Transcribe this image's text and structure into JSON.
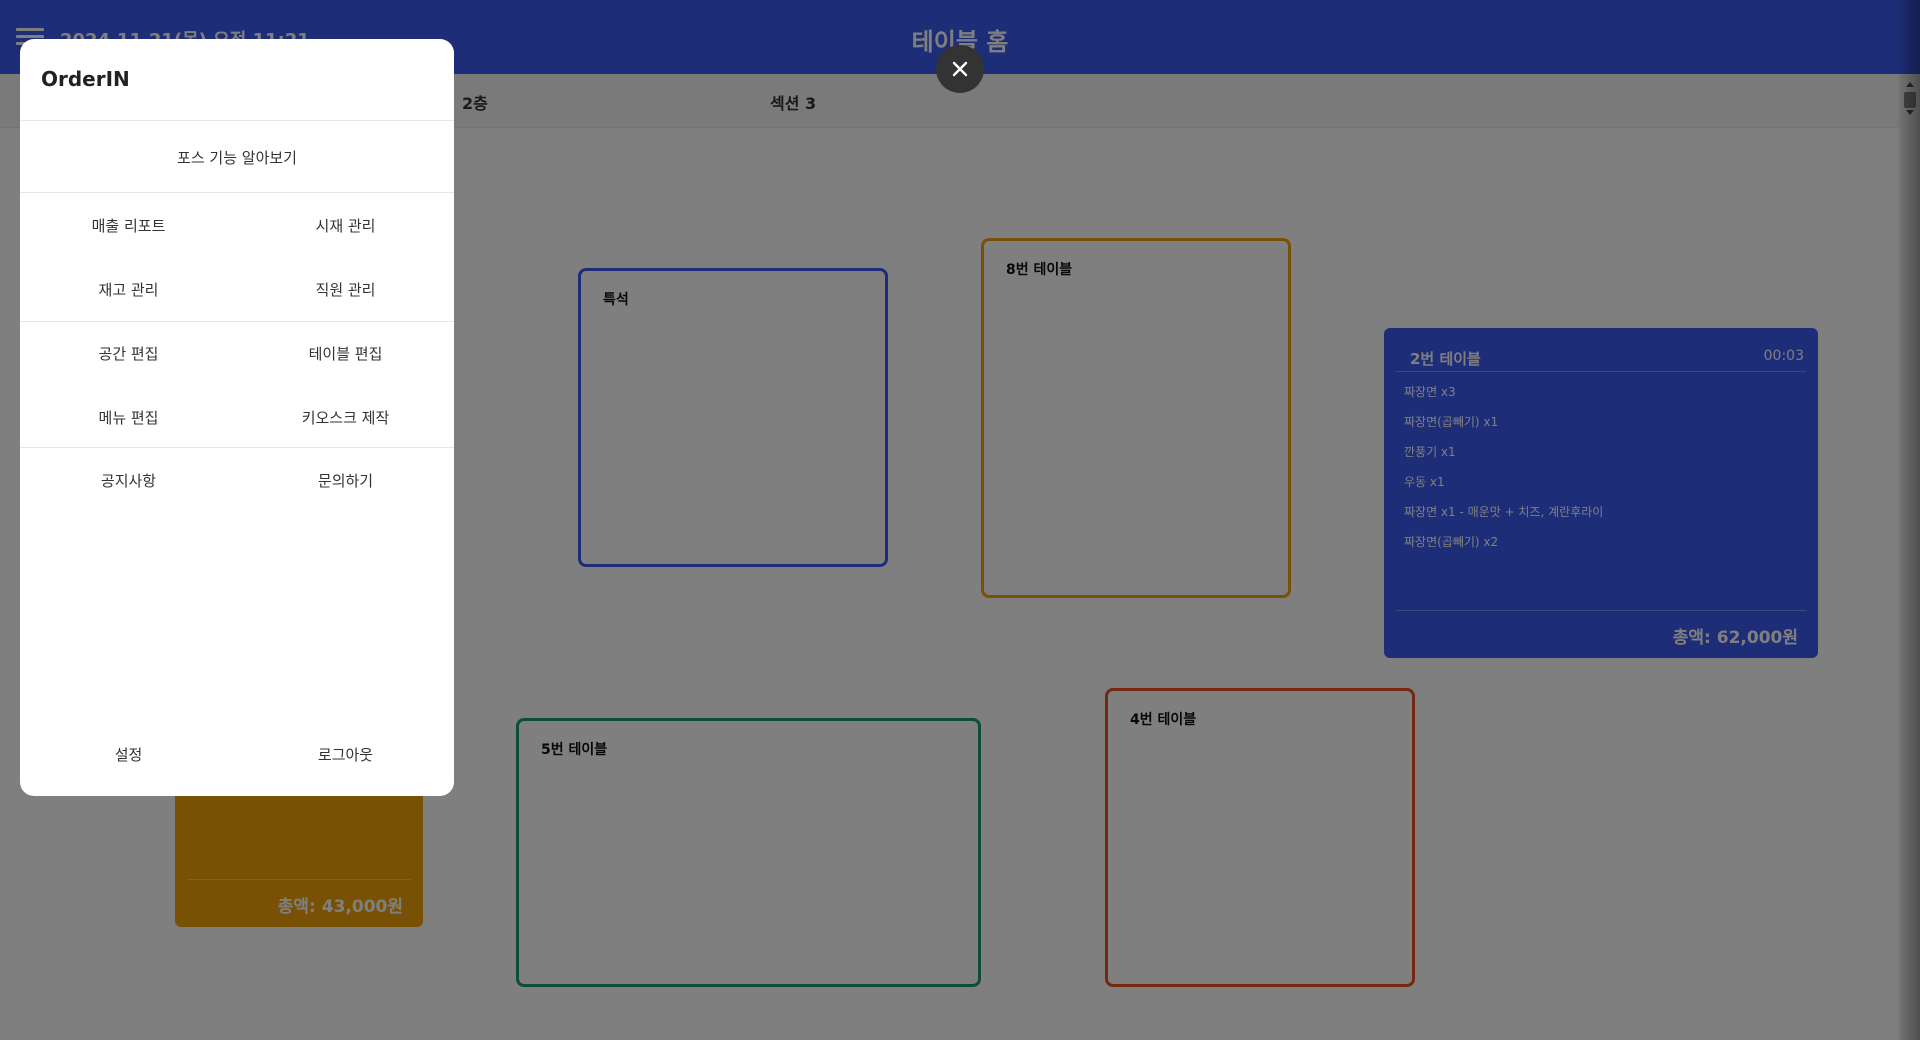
{
  "header": {
    "datetime": "2024.11.21(목) 오전 11:21",
    "title": "테이블 홈"
  },
  "tabs": [
    {
      "label": "2층"
    },
    {
      "label": "섹션 3"
    }
  ],
  "tables": [
    {
      "name": "특석",
      "color": "#3d5af1"
    },
    {
      "name": "8번 테이블",
      "color": "#f2a20a"
    },
    {
      "name": "5번 테이블",
      "color": "#1e9a6a"
    },
    {
      "name": "4번 테이블",
      "color": "#e8501e"
    }
  ],
  "occupied_table": {
    "name": "2번 테이블",
    "time": "00:03",
    "items": [
      "짜장면 x3",
      "짜장면(곱빼기) x1",
      "깐풍기 x1",
      "우동 x1",
      "짜장면 x1 - 매운맛 + 치즈, 계란후라이",
      "짜장면(곱빼기) x2"
    ],
    "total": "총액: 62,000원",
    "color": "#3d5af1"
  },
  "partial_table": {
    "total": "총액: 43,000원",
    "color": "#f2a20a"
  },
  "drawer": {
    "title": "OrderIN",
    "intro": "포스 기능 알아보기",
    "sales_report": "매출 리포트",
    "ingredient_mgmt": "시재 관리",
    "inventory_mgmt": "재고 관리",
    "staff_mgmt": "직원 관리",
    "space_edit": "공간 편집",
    "table_edit": "테이블 편집",
    "menu_edit": "메뉴 편집",
    "kiosk": "키오스크 제작",
    "notice": "공지사항",
    "inquiry": "문의하기",
    "settings": "설정",
    "logout": "로그아웃"
  },
  "icons": {
    "menu": "hamburger-menu-icon",
    "close": "close-icon"
  }
}
